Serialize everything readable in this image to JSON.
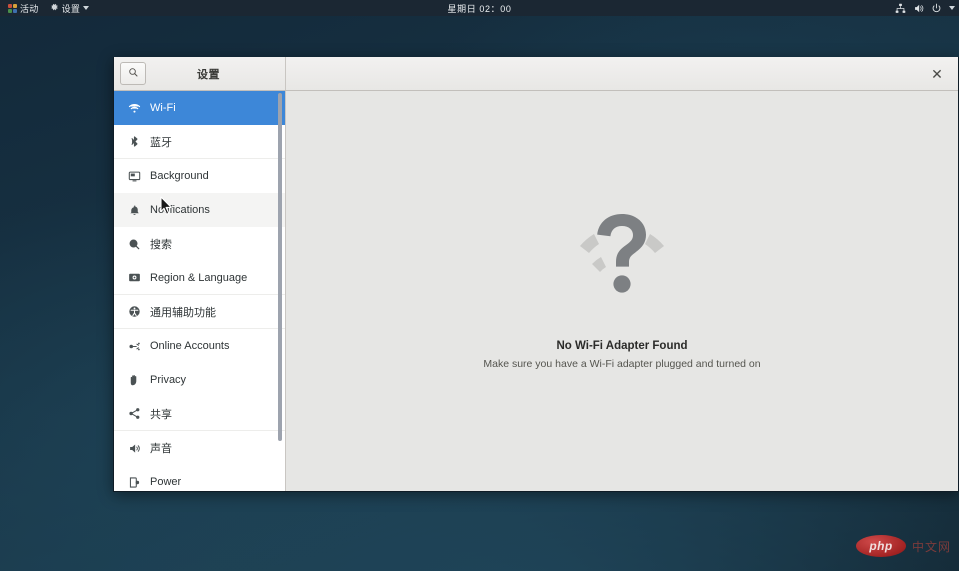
{
  "topbar": {
    "activities_label": "活动",
    "activities_icon": "activities-grid-icon",
    "app_menu_label": "设置",
    "app_menu_icon": "settings-gear-icon",
    "app_menu_caret": "chevron-down-icon",
    "clock": "星期日 02：00",
    "status_icons": [
      "network-wired-icon",
      "volume-speaker-icon",
      "power-icon"
    ],
    "status_caret": "chevron-down-icon"
  },
  "window": {
    "header": {
      "search_icon": "search-icon",
      "title": "设置",
      "close_label": "✕"
    }
  },
  "sidebar": {
    "items": [
      {
        "label": "Wi-Fi",
        "icon": "wifi-icon",
        "state": "selected"
      },
      {
        "label": "蓝牙",
        "icon": "bluetooth-icon",
        "state": "normal"
      },
      {
        "label": "Background",
        "icon": "background-monitor-icon",
        "state": "normal"
      },
      {
        "label": "Notifications",
        "icon": "bell-icon",
        "state": "hover"
      },
      {
        "label": "搜索",
        "icon": "search-icon",
        "state": "normal"
      },
      {
        "label": "Region & Language",
        "icon": "region-language-icon",
        "state": "normal"
      },
      {
        "label": "通用辅助功能",
        "icon": "universal-access-icon",
        "state": "normal"
      },
      {
        "label": "Online Accounts",
        "icon": "online-accounts-icon",
        "state": "normal"
      },
      {
        "label": "Privacy",
        "icon": "privacy-hand-icon",
        "state": "normal"
      },
      {
        "label": "共享",
        "icon": "sharing-nodes-icon",
        "state": "normal"
      },
      {
        "label": "声音",
        "icon": "sound-speaker-icon",
        "state": "normal"
      },
      {
        "label": "Power",
        "icon": "power-battery-icon",
        "state": "normal"
      }
    ]
  },
  "main": {
    "empty_state": {
      "icon": "wifi-question-mark-icon",
      "title": "No Wi-Fi Adapter Found",
      "subtitle": "Make sure you have a Wi-Fi adapter plugged and turned on"
    }
  },
  "watermark": {
    "badge": "php",
    "text": "中文网"
  },
  "colors": {
    "accent": "#3d87d8",
    "desktop": "#173041",
    "topbar": "#1b2733",
    "main_bg": "#e6e6e4",
    "sidebar_bg": "#ffffff"
  }
}
